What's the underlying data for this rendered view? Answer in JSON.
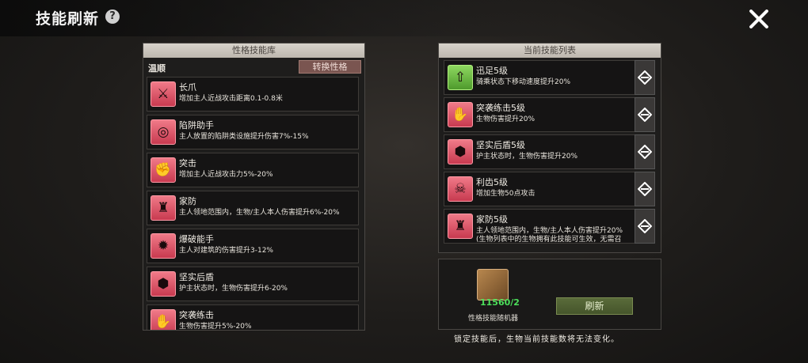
{
  "header": {
    "title": "技能刷新",
    "help_glyph": "?"
  },
  "left_panel": {
    "header": "性格技能库",
    "personality": "温顺",
    "switch_label": "转换性格",
    "skills": [
      {
        "name": "长爪",
        "desc": "增加主人近战攻击距离0.1-0.8米",
        "icon": "claw-icon",
        "glyph": "⚔"
      },
      {
        "name": "陷阱助手",
        "desc": "主人放置的陷阱类设施提升伤害7%-15%",
        "icon": "trap-icon",
        "glyph": "◎"
      },
      {
        "name": "突击",
        "desc": "增加主人近战攻击力5%-20%",
        "icon": "assault-icon",
        "glyph": "✊"
      },
      {
        "name": "家防",
        "desc": "主人领地范围内，生物/主人本人伤害提升6%-20%",
        "icon": "tower-icon",
        "glyph": "♜"
      },
      {
        "name": "爆破能手",
        "desc": "主人对建筑的伤害提升3-12%",
        "icon": "bomb-icon",
        "glyph": "✹"
      },
      {
        "name": "坚实后盾",
        "desc": "护主状态时，生物伤害提升6-20%",
        "icon": "shield-icon",
        "glyph": "⬢"
      },
      {
        "name": "突袭练击",
        "desc": "生物伤害提升5%-20%",
        "icon": "paw-icon",
        "glyph": "✋"
      }
    ]
  },
  "right_panel": {
    "header": "当前技能列表",
    "skills": [
      {
        "name": "迅足5级",
        "desc": "骑乘状态下移动速度提升20%",
        "icon": "speed-icon",
        "glyph": "⇧",
        "color": "green"
      },
      {
        "name": "突袭练击5级",
        "desc": "生物伤害提升20%",
        "icon": "paw-icon",
        "glyph": "✋",
        "color": "red"
      },
      {
        "name": "坚实后盾5级",
        "desc": "护主状态时，生物伤害提升20%",
        "icon": "shield-icon",
        "glyph": "⬢",
        "color": "red"
      },
      {
        "name": "利齿5级",
        "desc": "增加生物50点攻击",
        "icon": "fang-icon",
        "glyph": "☠",
        "color": "red"
      },
      {
        "name": "家防5级",
        "desc": "主人领地范围内，生物/主人本人伤害提升20%",
        "desc2": "(生物列表中的生物拥有此技能可生效，无需召",
        "icon": "tower-icon",
        "glyph": "♜",
        "color": "red"
      }
    ]
  },
  "refresh_box": {
    "count": "11560/2",
    "label": "性格技能随机器",
    "button_label": "刷新"
  },
  "footer_note": "锁定技能后，生物当前技能数将无法变化。",
  "colors": {
    "accent_red": "#e05a6c",
    "accent_green": "#6ec046",
    "count_green": "#4ce05a"
  }
}
